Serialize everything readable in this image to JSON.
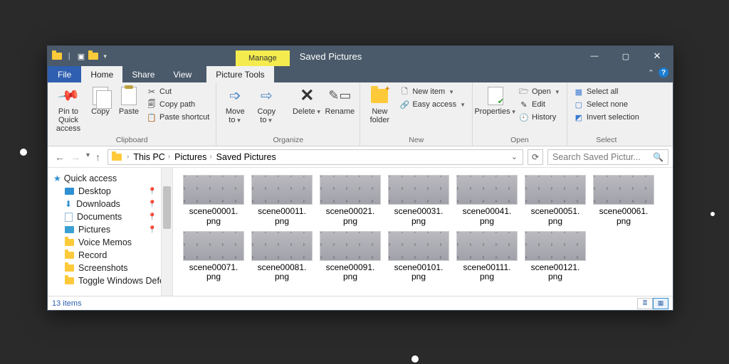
{
  "title": "Saved Pictures",
  "contextual_tab_group": "Manage",
  "tabs": {
    "file": "File",
    "home": "Home",
    "share": "Share",
    "view": "View",
    "context": "Picture Tools"
  },
  "ribbon": {
    "clipboard": {
      "label": "Clipboard",
      "pin": "Pin to Quick access",
      "copy": "Copy",
      "paste": "Paste",
      "cut": "Cut",
      "copypath": "Copy path",
      "pasteshortcut": "Paste shortcut"
    },
    "organize": {
      "label": "Organize",
      "moveto": "Move to",
      "copyto": "Copy to",
      "delete": "Delete",
      "rename": "Rename"
    },
    "new": {
      "label": "New",
      "newfolder": "New folder",
      "newitem": "New item",
      "easyaccess": "Easy access"
    },
    "open": {
      "label": "Open",
      "properties": "Properties",
      "open": "Open",
      "edit": "Edit",
      "history": "History"
    },
    "select": {
      "label": "Select",
      "all": "Select all",
      "none": "Select none",
      "invert": "Invert selection"
    }
  },
  "breadcrumbs": [
    "This PC",
    "Pictures",
    "Saved Pictures"
  ],
  "search_placeholder": "Search Saved Pictur...",
  "nav": {
    "quick": "Quick access",
    "items": [
      "Desktop",
      "Downloads",
      "Documents",
      "Pictures",
      "Voice Memos",
      "Record",
      "Screenshots",
      "Toggle Windows Defe"
    ]
  },
  "files": [
    "scene00001.png",
    "scene00011.png",
    "scene00021.png",
    "scene00031.png",
    "scene00041.png",
    "scene00051.png",
    "scene00061.png",
    "scene00071.png",
    "scene00081.png",
    "scene00091.png",
    "scene00101.png",
    "scene00111.png",
    "scene00121.png"
  ],
  "status": "13 items"
}
